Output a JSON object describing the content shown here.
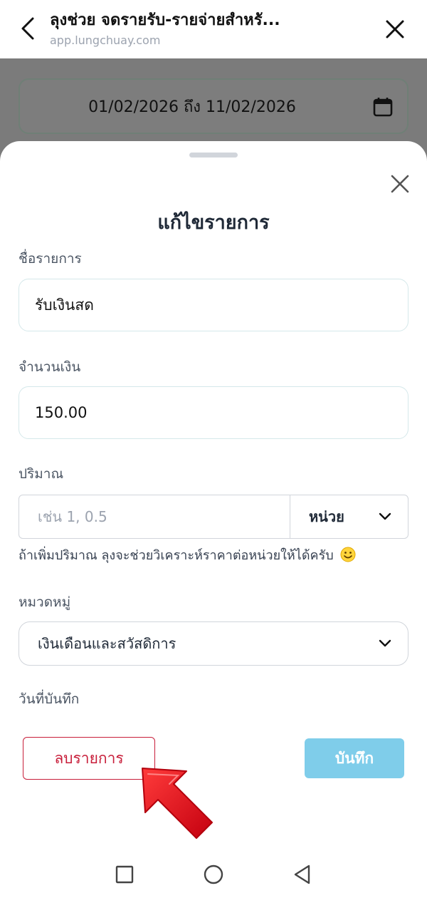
{
  "browser": {
    "title": "ลุงช่วย จดรายรับ-รายจ่ายสำหรั...",
    "url": "app.lungchuay.com",
    "back_icon": "chevron-left-icon",
    "close_icon": "close-icon"
  },
  "background_page": {
    "date_range": "01/02/2026 ถึง 11/02/2026",
    "calendar_icon": "calendar-icon"
  },
  "sheet": {
    "title": "แก้ไขรายการ",
    "close_icon": "close-icon",
    "fields": {
      "name": {
        "label": "ชื่อรายการ",
        "value": "รับเงินสด"
      },
      "amount": {
        "label": "จำนวนเงิน",
        "value": "150.00"
      },
      "quantity": {
        "label": "ปริมาณ",
        "placeholder": "เช่น 1, 0.5",
        "unit": "หน่วย",
        "hint": "ถ้าเพิ่มปริมาณ ลุงจะช่วยวิเคราะห์ราคาต่อหน่วยให้ได้ครับ"
      },
      "category": {
        "label": "หมวดหมู่",
        "value": "เงินเดือนและสวัสดิการ"
      },
      "record_date": {
        "label": "วันที่บันทึก"
      }
    },
    "buttons": {
      "delete": "ลบรายการ",
      "save": "บันทึก"
    }
  },
  "colors": {
    "delete_accent": "#c81e3a",
    "save_bg": "#7fcdea",
    "arrow": "#e0101e",
    "backdrop": "#7b7b7b"
  },
  "nav_bar": {
    "icons": [
      "square-recents-icon",
      "circle-home-icon",
      "triangle-back-icon"
    ]
  }
}
